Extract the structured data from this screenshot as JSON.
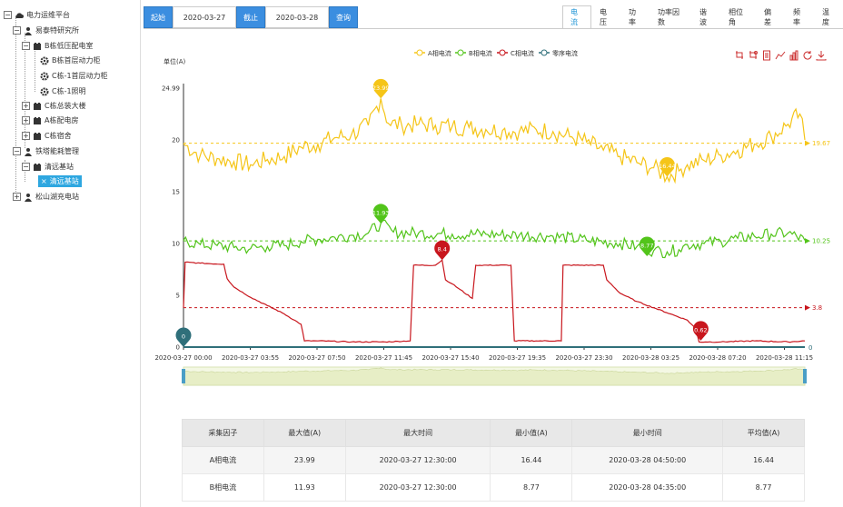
{
  "sidebar": {
    "items": [
      {
        "label": "电力运维平台",
        "toggle": "−",
        "icon": "cloud-icon"
      },
      {
        "label": "易泰特研究所",
        "toggle": "−",
        "icon": "person-icon"
      },
      {
        "label": "B栋低压配电室",
        "toggle": "−",
        "icon": "cabinet-icon"
      },
      {
        "label": "B栋首层动力柜",
        "toggle": "",
        "icon": "gear-icon"
      },
      {
        "label": "C栋-1首层动力柜",
        "toggle": "",
        "icon": "gear-icon"
      },
      {
        "label": "C栋-1照明",
        "toggle": "",
        "icon": "gear-icon"
      },
      {
        "label": "C栋总装大楼",
        "toggle": "+",
        "icon": "cabinet-icon"
      },
      {
        "label": "A栋配电房",
        "toggle": "+",
        "icon": "cabinet-icon"
      },
      {
        "label": "C栋宿舍",
        "toggle": "+",
        "icon": "cabinet-icon"
      },
      {
        "label": "铁塔能耗管理",
        "toggle": "−",
        "icon": "person-icon"
      },
      {
        "label": "清远基站",
        "toggle": "−",
        "icon": "cabinet-icon"
      },
      {
        "label": "清远基站",
        "toggle": "",
        "icon": "close-icon"
      },
      {
        "label": "松山湖充电站",
        "toggle": "+",
        "icon": "person-icon"
      }
    ]
  },
  "toolbar": {
    "start_label": "起始",
    "start_date": "2020-03-27",
    "end_label": "截止",
    "end_date": "2020-03-28",
    "query_label": "查询"
  },
  "tabs": [
    "电流",
    "电压",
    "功率",
    "功率因数",
    "谐波",
    "相位角",
    "偏差",
    "频率",
    "温度"
  ],
  "active_tab": 0,
  "colors": {
    "a": "#f5c518",
    "b": "#52c41a",
    "c": "#c8161d",
    "zero": "#2f6f7a",
    "accent": "#3b8ee0"
  },
  "chart_data": {
    "type": "line",
    "ylabel": "单位(A)",
    "ylim": [
      0,
      24.99
    ],
    "yticks": [
      "0",
      "5",
      "10",
      "15",
      "20",
      "24.99"
    ],
    "yticks_values": [
      0,
      5,
      10,
      15,
      20,
      24.99
    ],
    "x_tick_labels": [
      "2020-03-27 00:00",
      "2020-03-27 03:55",
      "2020-03-27 07:50",
      "2020-03-27 11:45",
      "2020-03-27 15:40",
      "2020-03-27 19:35",
      "2020-03-27 23:30",
      "2020-03-28 03:25",
      "2020-03-28 07:20",
      "2020-03-28 11:15"
    ],
    "x_hours_range": [
      0,
      37
    ],
    "series": [
      {
        "name": "A相电流",
        "color": "#f5c518",
        "points": [
          [
            0,
            19.6
          ],
          [
            1,
            18.5
          ],
          [
            2,
            18.2
          ],
          [
            3,
            17.9
          ],
          [
            4,
            17.6
          ],
          [
            5,
            18.1
          ],
          [
            6,
            18.4
          ],
          [
            7,
            19.3
          ],
          [
            8,
            19.6
          ],
          [
            9,
            20.2
          ],
          [
            10,
            20.5
          ],
          [
            11,
            21.4
          ],
          [
            11.75,
            23.99
          ],
          [
            12.2,
            21.6
          ],
          [
            13,
            21.4
          ],
          [
            14,
            21.5
          ],
          [
            15,
            21.4
          ],
          [
            16,
            21.3
          ],
          [
            17,
            21.2
          ],
          [
            18,
            21.0
          ],
          [
            19,
            20.9
          ],
          [
            20,
            20.8
          ],
          [
            21,
            21.0
          ],
          [
            22,
            20.8
          ],
          [
            23,
            20.3
          ],
          [
            24,
            19.8
          ],
          [
            25,
            19.0
          ],
          [
            26,
            18.4
          ],
          [
            27,
            17.8
          ],
          [
            28,
            17.3
          ],
          [
            28.8,
            16.44
          ],
          [
            29.5,
            17.0
          ],
          [
            30,
            17.6
          ],
          [
            31,
            18.0
          ],
          [
            32,
            18.5
          ],
          [
            33,
            19.0
          ],
          [
            34,
            19.6
          ],
          [
            35,
            20.3
          ],
          [
            36,
            21.5
          ],
          [
            36.7,
            22.5
          ],
          [
            37,
            20.0
          ]
        ],
        "avg": 19.67,
        "max": {
          "x": 11.75,
          "y": 23.99,
          "label": "23.99"
        },
        "min": {
          "x": 28.8,
          "y": 16.44,
          "label": "16.44"
        }
      },
      {
        "name": "B相电流",
        "color": "#52c41a",
        "points": [
          [
            0,
            10.3
          ],
          [
            1,
            9.9
          ],
          [
            2,
            9.8
          ],
          [
            3,
            9.6
          ],
          [
            4,
            9.5
          ],
          [
            5,
            9.7
          ],
          [
            6,
            9.8
          ],
          [
            7,
            10.2
          ],
          [
            8,
            10.4
          ],
          [
            9,
            10.6
          ],
          [
            10,
            10.8
          ],
          [
            11,
            11.0
          ],
          [
            11.75,
            11.93
          ],
          [
            12.5,
            11.1
          ],
          [
            14,
            11.0
          ],
          [
            16,
            10.9
          ],
          [
            18,
            10.9
          ],
          [
            20,
            10.8
          ],
          [
            22,
            10.7
          ],
          [
            24,
            10.3
          ],
          [
            26,
            10.0
          ],
          [
            27,
            9.7
          ],
          [
            28,
            9.3
          ],
          [
            28.8,
            9.2
          ],
          [
            29.5,
            9.4
          ],
          [
            30,
            9.9
          ],
          [
            31,
            10.0
          ],
          [
            32,
            10.2
          ],
          [
            33,
            10.5
          ],
          [
            34,
            10.7
          ],
          [
            35,
            10.9
          ],
          [
            36,
            11.0
          ],
          [
            37,
            10.3
          ]
        ],
        "avg": 10.25,
        "max": {
          "x": 11.75,
          "y": 11.93,
          "label": "11.93"
        },
        "min": {
          "x": 27.6,
          "y": 8.77,
          "label": "8.77"
        }
      },
      {
        "name": "C相电流",
        "color": "#c8161d",
        "points": [
          [
            0,
            3.8
          ],
          [
            0.1,
            8.2
          ],
          [
            1,
            8.1
          ],
          [
            2.4,
            8.0
          ],
          [
            2.6,
            6.6
          ],
          [
            3,
            5.8
          ],
          [
            4,
            4.8
          ],
          [
            5,
            4.0
          ],
          [
            6,
            3.2
          ],
          [
            7,
            2.2
          ],
          [
            7.2,
            0.6
          ],
          [
            8,
            0.6
          ],
          [
            10,
            0.5
          ],
          [
            12,
            0.5
          ],
          [
            13.5,
            0.6
          ],
          [
            13.7,
            7.9
          ],
          [
            15,
            7.9
          ],
          [
            15.4,
            8.4
          ],
          [
            15.6,
            6.5
          ],
          [
            16,
            6.1
          ],
          [
            17.2,
            4.7
          ],
          [
            17.4,
            7.9
          ],
          [
            19.5,
            7.9
          ],
          [
            19.7,
            0.6
          ],
          [
            21,
            0.6
          ],
          [
            22.5,
            0.6
          ],
          [
            22.6,
            7.9
          ],
          [
            25,
            7.9
          ],
          [
            25.2,
            6.5
          ],
          [
            26,
            5.2
          ],
          [
            27,
            4.4
          ],
          [
            28,
            3.8
          ],
          [
            29,
            3.2
          ],
          [
            30,
            2.6
          ],
          [
            30.5,
            1.8
          ],
          [
            30.7,
            0.5
          ],
          [
            32,
            0.5
          ],
          [
            34,
            0.6
          ],
          [
            36,
            0.5
          ],
          [
            37,
            0.6
          ]
        ],
        "avg": 3.8,
        "max": {
          "x": 15.4,
          "y": 8.4,
          "label": "8.4"
        },
        "min": {
          "x": 30.8,
          "y": 0.62,
          "label": "0.62"
        }
      },
      {
        "name": "零序电流",
        "color": "#2f6f7a",
        "points": [
          [
            0,
            0
          ],
          [
            37,
            0
          ]
        ],
        "avg": 0,
        "max": {
          "x": 0,
          "y": 0,
          "label": "0"
        },
        "min": null
      }
    ]
  },
  "toolbox": [
    "zoom-icon",
    "zoom-reset-icon",
    "data-view-icon",
    "line-icon",
    "bar-icon",
    "refresh-icon",
    "download-icon"
  ],
  "table": {
    "headers": [
      "采集因子",
      "最大值(A)",
      "最大时间",
      "最小值(A)",
      "最小时间",
      "平均值(A)"
    ],
    "rows": [
      [
        "A相电流",
        "23.99",
        "2020-03-27 12:30:00",
        "16.44",
        "2020-03-28 04:50:00",
        "16.44"
      ],
      [
        "B相电流",
        "11.93",
        "2020-03-27 12:30:00",
        "8.77",
        "2020-03-28 04:35:00",
        "8.77"
      ]
    ]
  }
}
